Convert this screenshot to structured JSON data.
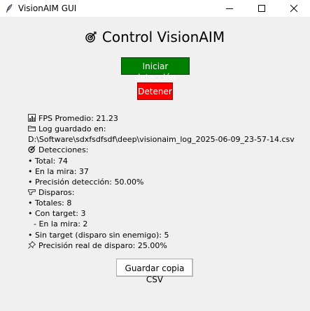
{
  "window": {
    "title": "VisionAIM GUI",
    "icon": "feather-icon"
  },
  "heading": {
    "icon": "target-icon",
    "text": "Control VisionAIM"
  },
  "buttons": {
    "start": "Iniciar detección",
    "stop": "Detener",
    "save": "Guardar copia CSV"
  },
  "colors": {
    "start_bg": "#008000",
    "stop_bg": "#ff0000",
    "window_bg": "#f0f0f0"
  },
  "stats": {
    "fps": "FPS Promedio: 21.23",
    "log_label": "Log guardado en:",
    "log_path": "D:\\Software\\sdxfsdfsdf\\deep\\visionaim_log_2025-06-09_23-57-14.csv",
    "detections_header": "Detecciones:",
    "det_total": "• Total: 74",
    "det_on_target": "• En la mira: 37",
    "det_precision": "• Precisión detección: 50.00%",
    "shots_header": "Disparos:",
    "shots_total": "• Totales: 8",
    "shots_with_target": "• Con target: 3",
    "shots_on_target": "- En la mira: 2",
    "shots_no_target": "• Sin target (disparo sin enemigo): 5",
    "real_precision": "Precisión real de disparo: 25.00%"
  }
}
